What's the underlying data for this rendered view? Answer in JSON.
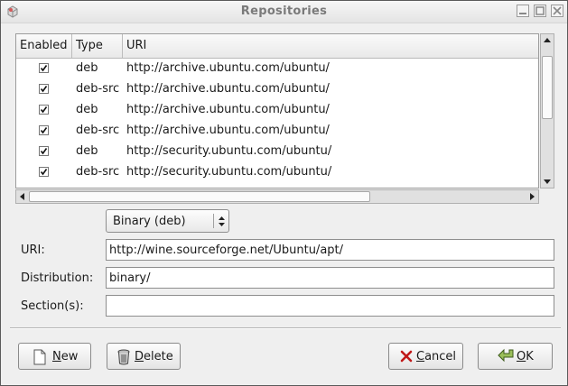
{
  "window": {
    "title": "Repositories"
  },
  "table": {
    "headers": [
      "Enabled",
      "Type",
      "URI"
    ],
    "rows": [
      {
        "enabled": true,
        "type": "deb",
        "uri": "http://archive.ubuntu.com/ubuntu/"
      },
      {
        "enabled": true,
        "type": "deb-src",
        "uri": "http://archive.ubuntu.com/ubuntu/"
      },
      {
        "enabled": true,
        "type": "deb",
        "uri": "http://archive.ubuntu.com/ubuntu/"
      },
      {
        "enabled": true,
        "type": "deb-src",
        "uri": "http://archive.ubuntu.com/ubuntu/"
      },
      {
        "enabled": true,
        "type": "deb",
        "uri": "http://security.ubuntu.com/ubuntu/"
      },
      {
        "enabled": true,
        "type": "deb-src",
        "uri": "http://security.ubuntu.com/ubuntu/"
      }
    ]
  },
  "form": {
    "type_select": "Binary (deb)",
    "uri_label": "URI:",
    "uri_value": "http://wine.sourceforge.net/Ubuntu/apt/",
    "distribution_label": "Distribution:",
    "distribution_value": "binary/",
    "sections_label": "Section(s):",
    "sections_value": ""
  },
  "buttons": {
    "new": {
      "mnemonic": "N",
      "rest": "ew"
    },
    "delete": {
      "mnemonic": "D",
      "rest": "elete"
    },
    "cancel": {
      "mnemonic": "C",
      "rest": "ancel"
    },
    "ok": {
      "mnemonic": "O",
      "rest": "K"
    }
  },
  "icons": {
    "app": "package-icon",
    "minimize": "minimize-icon",
    "maximize": "maximize-icon",
    "close": "close-icon",
    "new": "document-icon",
    "delete": "trash-icon",
    "cancel": "cancel-x-icon",
    "ok": "ok-arrow-icon"
  }
}
